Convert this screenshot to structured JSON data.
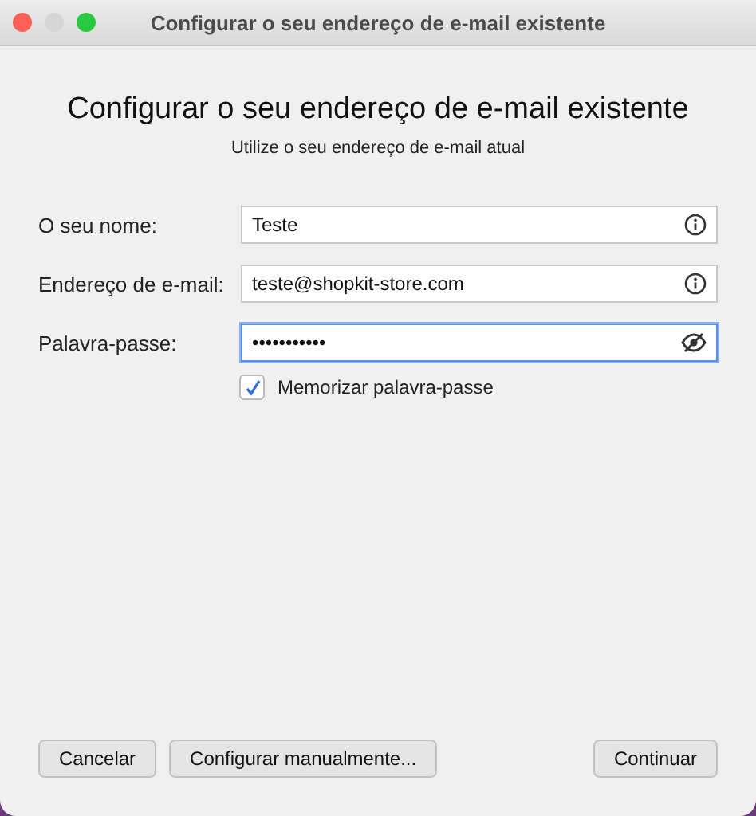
{
  "window": {
    "title": "Configurar o seu endereço de e-mail existente"
  },
  "heading": "Configurar o seu endereço de e-mail existente",
  "subtitle": "Utilize o seu endereço de e-mail atual",
  "fields": [
    {
      "label": "O seu nome:",
      "value": "Teste",
      "kind": "info",
      "focused": false
    },
    {
      "label": "Endereço de e-mail:",
      "value": "teste@shopkit-store.com",
      "kind": "info",
      "focused": false
    },
    {
      "label": "Palavra-passe:",
      "value": "•••••••••••",
      "kind": "password",
      "focused": true
    }
  ],
  "remember": {
    "label": "Memorizar palavra-passe",
    "checked": true
  },
  "buttons": [
    {
      "label": "Cancelar",
      "kind": "secondary"
    },
    {
      "label": "Configurar manualmente...",
      "kind": "secondary"
    },
    {
      "label": "Continuar",
      "kind": "primary"
    }
  ]
}
